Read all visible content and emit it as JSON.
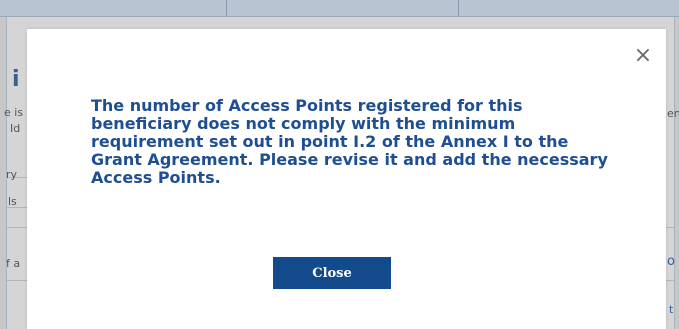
{
  "dialog": {
    "message": "The number of Access Points registered for this beneficiary does not comply with the minimum requirement set out in point I.2 of the Annex I to the Grant Agreement. Please revise it and add the necessary Access Points.",
    "close_label": "Close",
    "close_icon": "×"
  },
  "background": {
    "heading_fragment": "i",
    "left_fragments": [
      "e is",
      "Id",
      "ry",
      "ls",
      "f a"
    ],
    "right_fragments": [
      "en",
      "o",
      "t"
    ]
  },
  "colors": {
    "message_text": "#1f4f91",
    "button_bg": "#124a8c",
    "overlay": "#c7c7c7"
  }
}
